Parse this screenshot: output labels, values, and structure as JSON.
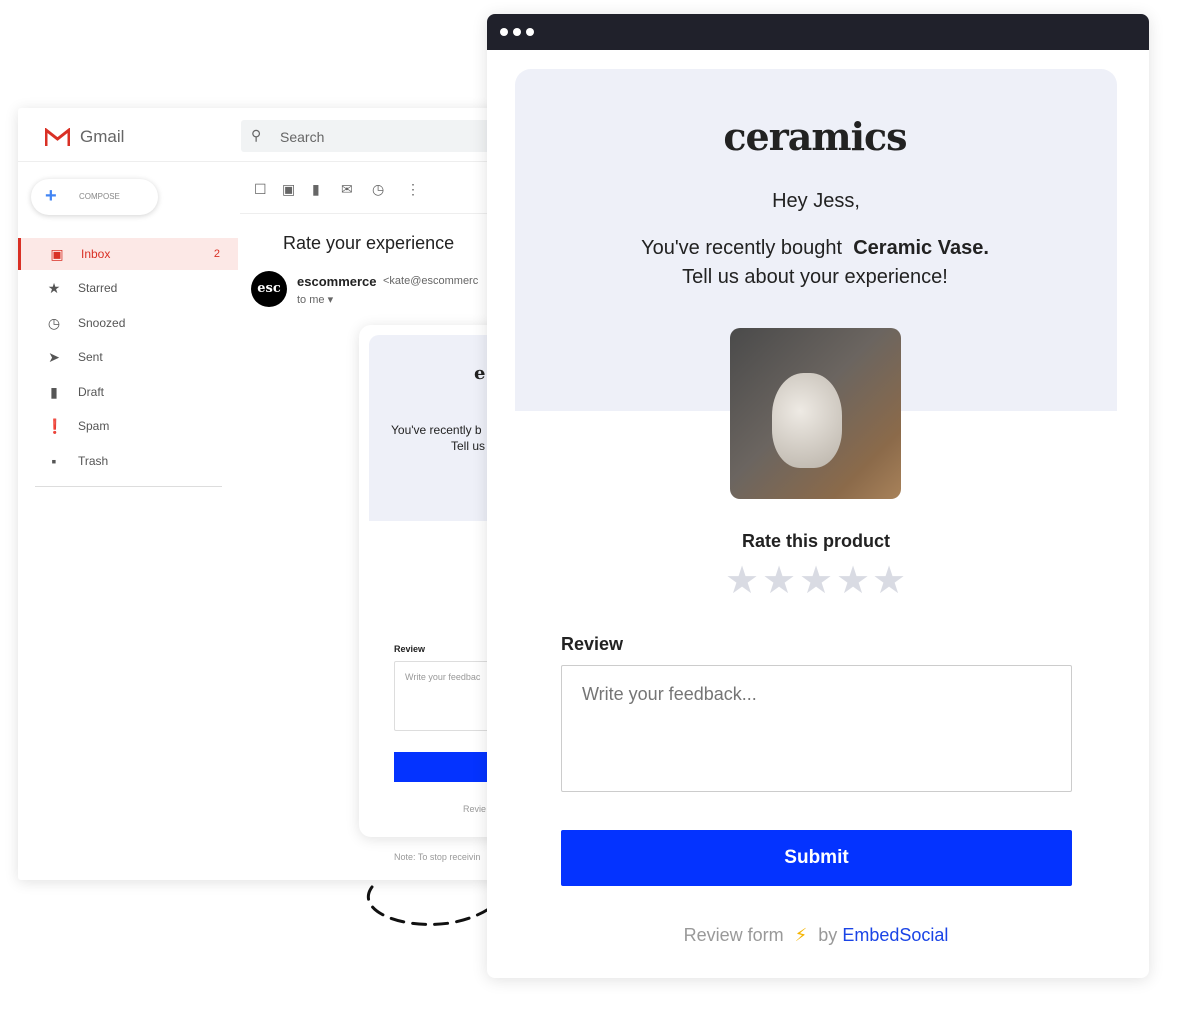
{
  "gmail": {
    "app_name": "Gmail",
    "search_placeholder": "Search",
    "compose": "COMPOSE",
    "nav": [
      {
        "label": "Inbox",
        "icon": "inbox-icon",
        "count": "2"
      },
      {
        "label": "Starred",
        "icon": "star-icon"
      },
      {
        "label": "Snoozed",
        "icon": "clock-icon"
      },
      {
        "label": "Sent",
        "icon": "send-icon"
      },
      {
        "label": "Draft",
        "icon": "draft-icon"
      },
      {
        "label": "Spam",
        "icon": "spam-icon"
      },
      {
        "label": "Trash",
        "icon": "trash-icon"
      }
    ],
    "subject": "Rate your experience",
    "sender": "escommerce",
    "sender_email": "<kate@escommerc",
    "recipient": "to me",
    "avatar_text": "esc",
    "preview": {
      "logo": "e",
      "line1": "You've recently b",
      "line2": "Tell us",
      "review_label": "Review",
      "placeholder": "Write your feedbac",
      "footer": "Revie",
      "note": "Note: To stop receivin"
    }
  },
  "card": {
    "logo": "ceramics",
    "greeting": "Hey Jess,",
    "bought_prefix": "You've recently bought",
    "product": "Ceramic Vase.",
    "prompt": "Tell us about your experience!",
    "rate_label": "Rate this product",
    "rating": 0,
    "stars_total": 5,
    "review_label": "Review",
    "review_placeholder": "Write your feedback...",
    "submit": "Submit",
    "footer_prefix": "Review form",
    "footer_by": "by",
    "footer_brand": "EmbedSocial"
  },
  "colors": {
    "accent": "#0433ff",
    "gmail_red": "#d93025",
    "panel": "#eef0f8",
    "brand_link": "#1a44e6",
    "bolt": "#f5b400"
  }
}
